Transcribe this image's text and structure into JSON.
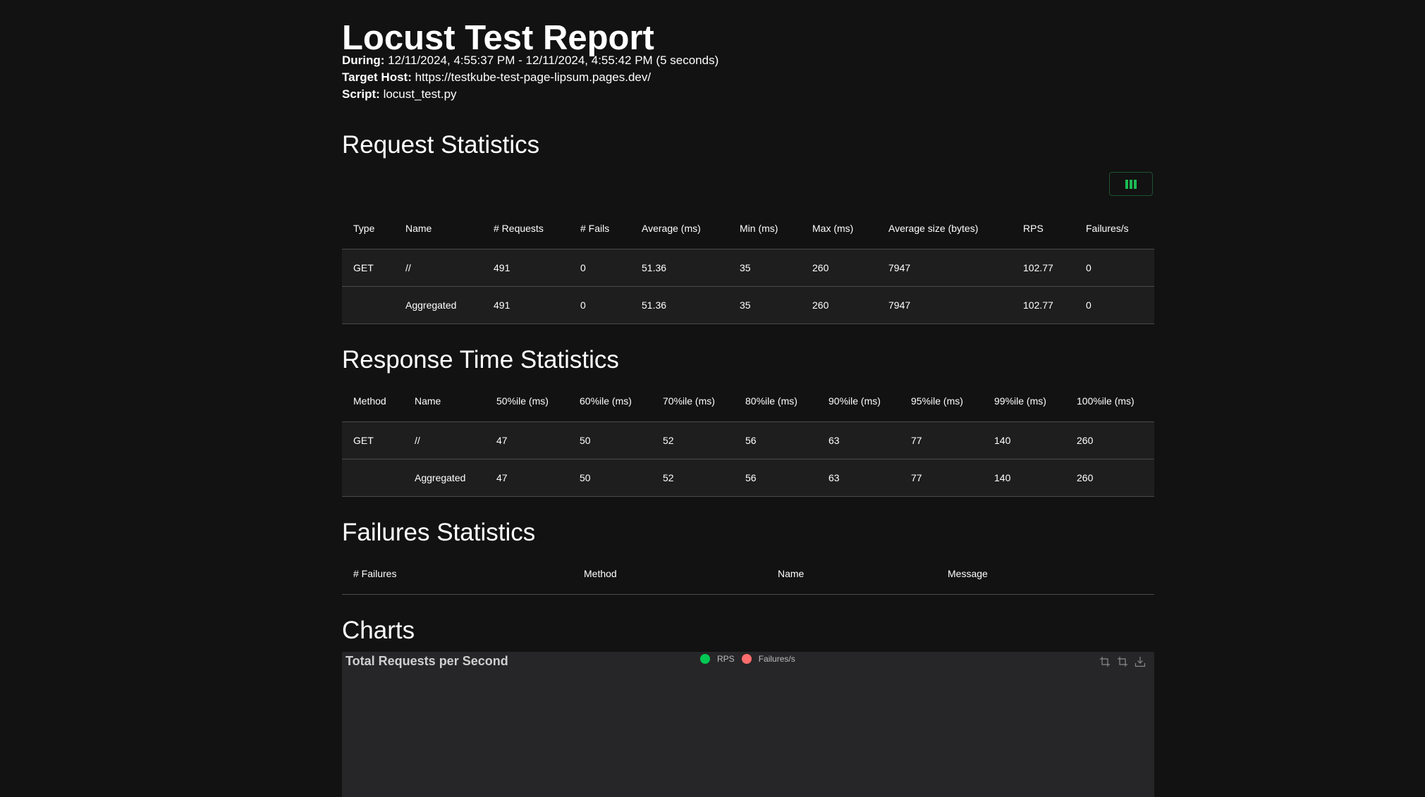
{
  "report": {
    "title": "Locust Test Report",
    "during_label": "During:",
    "during_value": "12/11/2024, 4:55:37 PM - 12/11/2024, 4:55:42 PM (5 seconds)",
    "host_label": "Target Host:",
    "host_value": "https://testkube-test-page-lipsum.pages.dev/",
    "script_label": "Script:",
    "script_value": "locust_test.py"
  },
  "request_stats": {
    "heading": "Request Statistics",
    "columns_button_icon": "columns-icon",
    "headers": [
      "Type",
      "Name",
      "# Requests",
      "# Fails",
      "Average (ms)",
      "Min (ms)",
      "Max (ms)",
      "Average size (bytes)",
      "RPS",
      "Failures/s"
    ],
    "rows": [
      [
        "GET",
        "//",
        "491",
        "0",
        "51.36",
        "35",
        "260",
        "7947",
        "102.77",
        "0"
      ],
      [
        "",
        "Aggregated",
        "491",
        "0",
        "51.36",
        "35",
        "260",
        "7947",
        "102.77",
        "0"
      ]
    ]
  },
  "response_stats": {
    "heading": "Response Time Statistics",
    "headers": [
      "Method",
      "Name",
      "50%ile (ms)",
      "60%ile (ms)",
      "70%ile (ms)",
      "80%ile (ms)",
      "90%ile (ms)",
      "95%ile (ms)",
      "99%ile (ms)",
      "100%ile (ms)"
    ],
    "rows": [
      [
        "GET",
        "//",
        "47",
        "50",
        "52",
        "56",
        "63",
        "77",
        "140",
        "260"
      ],
      [
        "",
        "Aggregated",
        "47",
        "50",
        "52",
        "56",
        "63",
        "77",
        "140",
        "260"
      ]
    ]
  },
  "failures_stats": {
    "heading": "Failures Statistics",
    "headers": [
      "# Failures",
      "Method",
      "Name",
      "Message"
    ]
  },
  "charts": {
    "heading": "Charts",
    "chart_title": "Total Requests per Second",
    "legend": [
      {
        "label": "RPS",
        "color": "#00c853"
      },
      {
        "label": "Failures/s",
        "color": "#ff6d6d"
      }
    ],
    "tool_icons": [
      "zoom-icon",
      "zoom-reset-icon",
      "download-icon"
    ]
  }
}
